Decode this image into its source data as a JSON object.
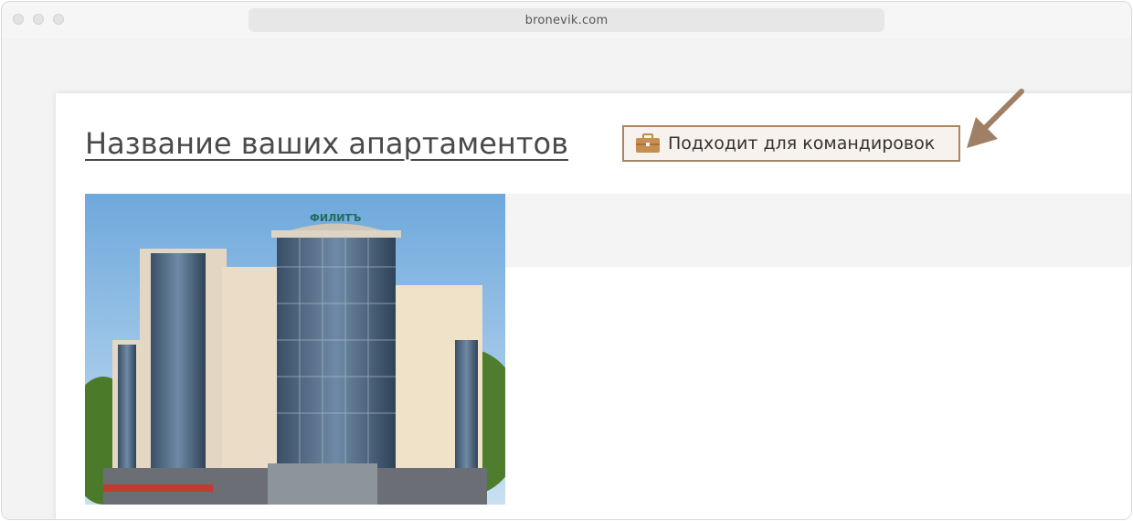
{
  "browser": {
    "url": "bronevik.com"
  },
  "listing": {
    "title": "Название ваших апартаментов",
    "badge_label": "Подходит для командировок",
    "badge_icon": "briefcase-icon",
    "accent_color": "#a88564",
    "photo_sign": "ФИЛИТЪ"
  }
}
